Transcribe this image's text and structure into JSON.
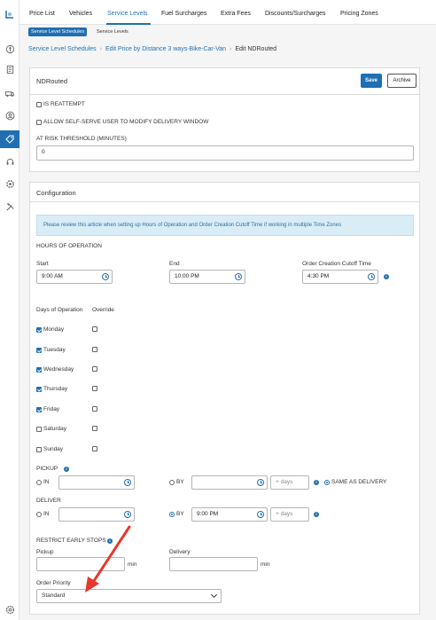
{
  "sidebar": {
    "icons": [
      "logo-icon",
      "price-icon",
      "document-icon",
      "truck-icon",
      "user-circle-icon",
      "tag-icon",
      "headset-icon",
      "gear-face-icon",
      "tools-icon",
      "settings-icon"
    ]
  },
  "tabs": [
    {
      "label": "Price List"
    },
    {
      "label": "Vehicles"
    },
    {
      "label": "Service Levels"
    },
    {
      "label": "Fuel Surcharges"
    },
    {
      "label": "Extra Fees"
    },
    {
      "label": "Discounts/Surcharges"
    },
    {
      "label": "Pricing Zones"
    }
  ],
  "subtabs": [
    {
      "label": "Service Level Schedules"
    },
    {
      "label": "Service Levels"
    }
  ],
  "breadcrumb": [
    {
      "label": "Service Level Schedules"
    },
    {
      "label": "Edit Price by Distance 3 ways-Bike-Car-Van"
    },
    {
      "label": "Edit NDRouted"
    }
  ],
  "header_panel": {
    "title": "NDRouted",
    "save_label": "Save",
    "archive_label": "Archive",
    "reattempt_label": "IS REATTEMPT",
    "self_serve_label": "ALLOW SELF-SERVE USER TO MODIFY DELIVERY WINDOW",
    "risk_label": "AT RISK THRESHOLD (MINUTES)",
    "risk_value": "0"
  },
  "config": {
    "title": "Configuration",
    "info_pre": "Please review this",
    "info_link": "article",
    "info_post": "when setting up Hours of Operation and Order Creation Cutoff Time if working in multiple Time Zones",
    "hours_label": "HOURS OF OPERATION",
    "start_label": "Start",
    "start_value": "9:00 AM",
    "end_label": "End",
    "end_value": "10:00 PM",
    "cutoff_label": "Order Creation Cutoff Time",
    "cutoff_value": "4:30 PM",
    "days_header": "Days of Operation",
    "override_header": "Override",
    "days": [
      {
        "label": "Monday",
        "checked": true
      },
      {
        "label": "Tuesday",
        "checked": true
      },
      {
        "label": "Wednesday",
        "checked": true
      },
      {
        "label": "Thursday",
        "checked": true
      },
      {
        "label": "Friday",
        "checked": true
      },
      {
        "label": "Saturday",
        "checked": false
      },
      {
        "label": "Sunday",
        "checked": false
      }
    ],
    "pickup_label": "PICKUP",
    "pickup_in": "IN",
    "pickup_by": "BY",
    "pickup_days_placeholder": "+ days",
    "same_as_delivery": "SAME AS DELIVERY",
    "deliver_label": "DELIVER",
    "deliver_in": "IN",
    "deliver_by": "BY",
    "deliver_by_value": "9:00 PM",
    "deliver_days_placeholder": "+ days",
    "restrict_label": "RESTRICT EARLY STOPS",
    "pickup_sub": "Pickup",
    "delivery_sub": "Delivery",
    "min_label": "min",
    "priority_label": "Order Priority",
    "priority_value": "Standard"
  },
  "colors": {
    "accent": "#1f6fb2",
    "annotation": "#e8372c"
  }
}
